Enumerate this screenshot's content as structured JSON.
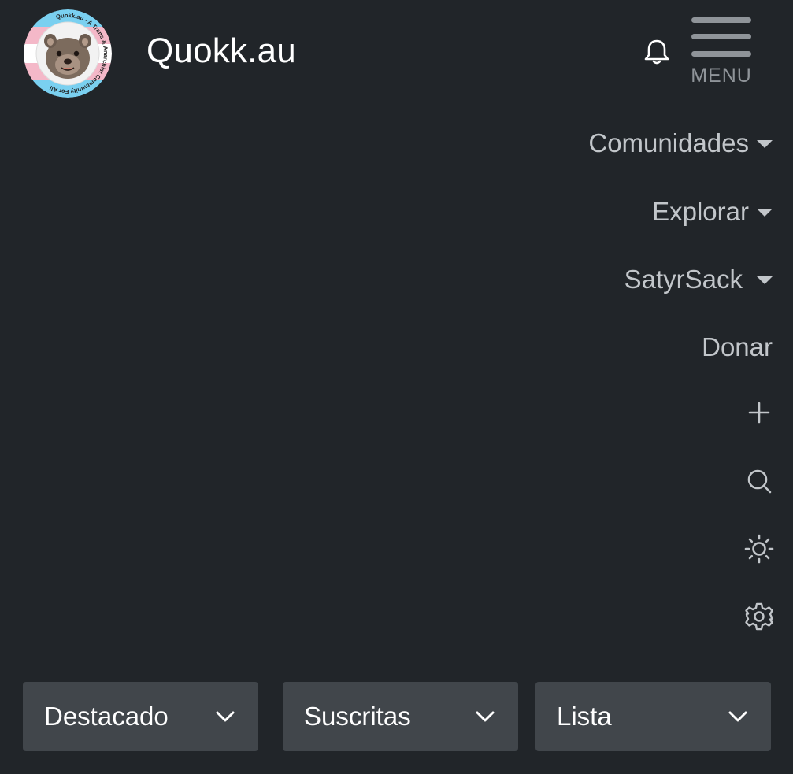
{
  "header": {
    "site_title": "Quokk.au",
    "logo": {
      "icon": "quokka-logo",
      "ring_text": "Quokk.au - A Trans & Anarchist Community For All"
    },
    "notifications_icon": "bell-icon",
    "menu_label": "MENU"
  },
  "nav": {
    "items": [
      {
        "label": "Comunidades",
        "has_dropdown": true
      },
      {
        "label": "Explorar",
        "has_dropdown": true
      },
      {
        "label": "SatyrSack",
        "has_dropdown": true
      },
      {
        "label": "Donar",
        "has_dropdown": false
      }
    ],
    "icons": [
      "plus-icon",
      "search-icon",
      "sun-icon",
      "gear-icon"
    ]
  },
  "filters": {
    "sort": "Destacado",
    "scope": "Suscritas",
    "view": "Lista"
  },
  "colors": {
    "background": "#212529",
    "select_background": "#41464b",
    "text": "#c2c6ca",
    "title": "#ffffff"
  }
}
